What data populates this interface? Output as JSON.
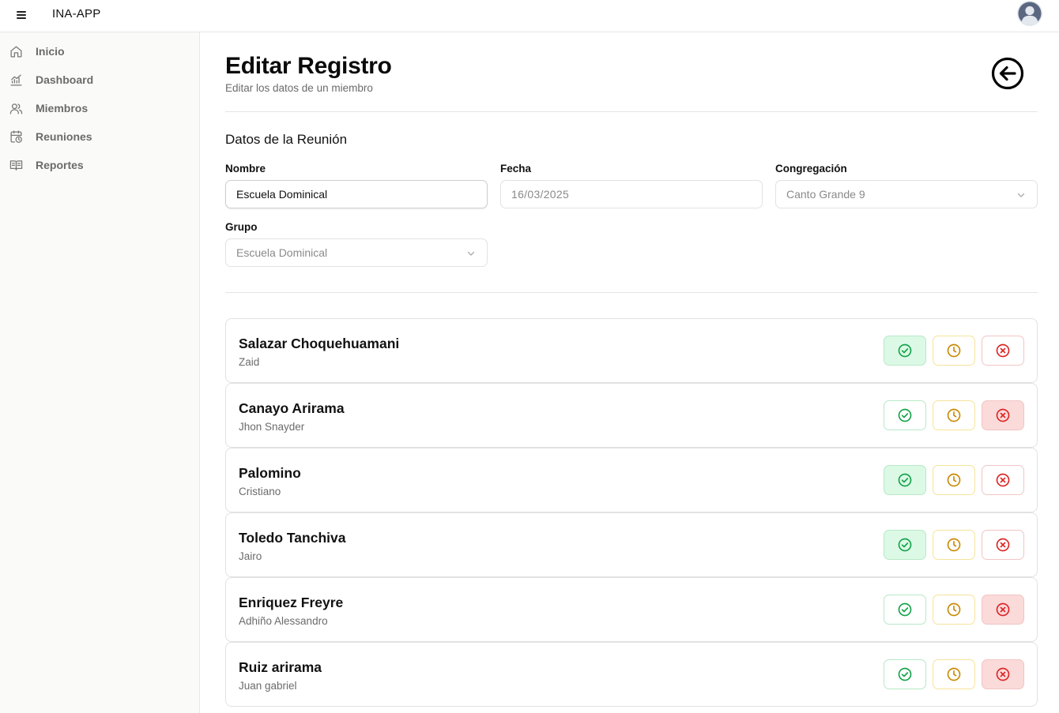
{
  "app": {
    "title": "INA-APP"
  },
  "sidebar": {
    "items": [
      {
        "label": "Inicio",
        "icon": "home-icon"
      },
      {
        "label": "Dashboard",
        "icon": "chart-icon"
      },
      {
        "label": "Miembros",
        "icon": "users-icon"
      },
      {
        "label": "Reuniones",
        "icon": "calendar-clock-icon"
      },
      {
        "label": "Reportes",
        "icon": "book-icon"
      }
    ]
  },
  "page": {
    "title": "Editar Registro",
    "subtitle": "Editar los datos de un miembro"
  },
  "section": {
    "title": "Datos de la Reunión"
  },
  "form": {
    "nombre": {
      "label": "Nombre",
      "value": "Escuela Dominical"
    },
    "fecha": {
      "label": "Fecha",
      "value": "16/03/2025"
    },
    "congregacion": {
      "label": "Congregación",
      "value": "Canto Grande 9"
    },
    "grupo": {
      "label": "Grupo",
      "value": "Escuela Dominical"
    }
  },
  "colors": {
    "present": "#16a34a",
    "late": "#ca8a04",
    "absent": "#dc2626"
  },
  "members": [
    {
      "last_name": "Salazar Choquehuamani",
      "first_name": "Zaid",
      "status": "present"
    },
    {
      "last_name": "Canayo Arirama",
      "first_name": "Jhon Snayder",
      "status": "absent"
    },
    {
      "last_name": "Palomino",
      "first_name": "Cristiano",
      "status": "present"
    },
    {
      "last_name": "Toledo Tanchiva",
      "first_name": "Jairo",
      "status": "present"
    },
    {
      "last_name": "Enriquez Freyre",
      "first_name": "Adhiño Alessandro",
      "status": "absent"
    },
    {
      "last_name": "Ruiz arirama",
      "first_name": "Juan gabriel",
      "status": "absent"
    }
  ]
}
